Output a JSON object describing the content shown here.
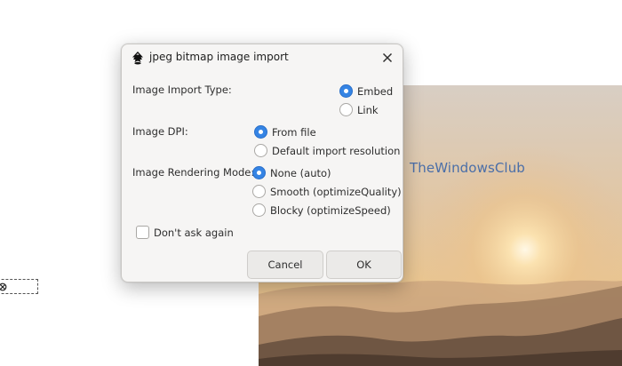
{
  "watermark": {
    "text": "TheWindowsClub"
  },
  "dialog": {
    "title": "jpeg bitmap image import",
    "import_type": {
      "label": "Image Import Type:",
      "options": [
        "Embed",
        "Link"
      ],
      "selected": "Embed"
    },
    "dpi": {
      "label": "Image DPI:",
      "options": [
        "From file",
        "Default import resolution"
      ],
      "selected": "From file"
    },
    "rendering": {
      "label": "Image Rendering Mode:",
      "options": [
        "None (auto)",
        "Smooth (optimizeQuality)",
        "Blocky (optimizeSpeed)"
      ],
      "selected": "None (auto)"
    },
    "dont_ask": {
      "label": "Don't ask again",
      "checked": false
    },
    "buttons": {
      "cancel": "Cancel",
      "ok": "OK"
    }
  },
  "colors": {
    "accent": "#3584e4",
    "dialog_bg": "#f6f5f4",
    "watermark": "#4a6ea8"
  },
  "icons": {
    "app": "inkscape-icon",
    "close": "close-icon",
    "watermark_logo": "windowsclub-logo-icon",
    "selection_handle": "rotate-handle-icon"
  }
}
